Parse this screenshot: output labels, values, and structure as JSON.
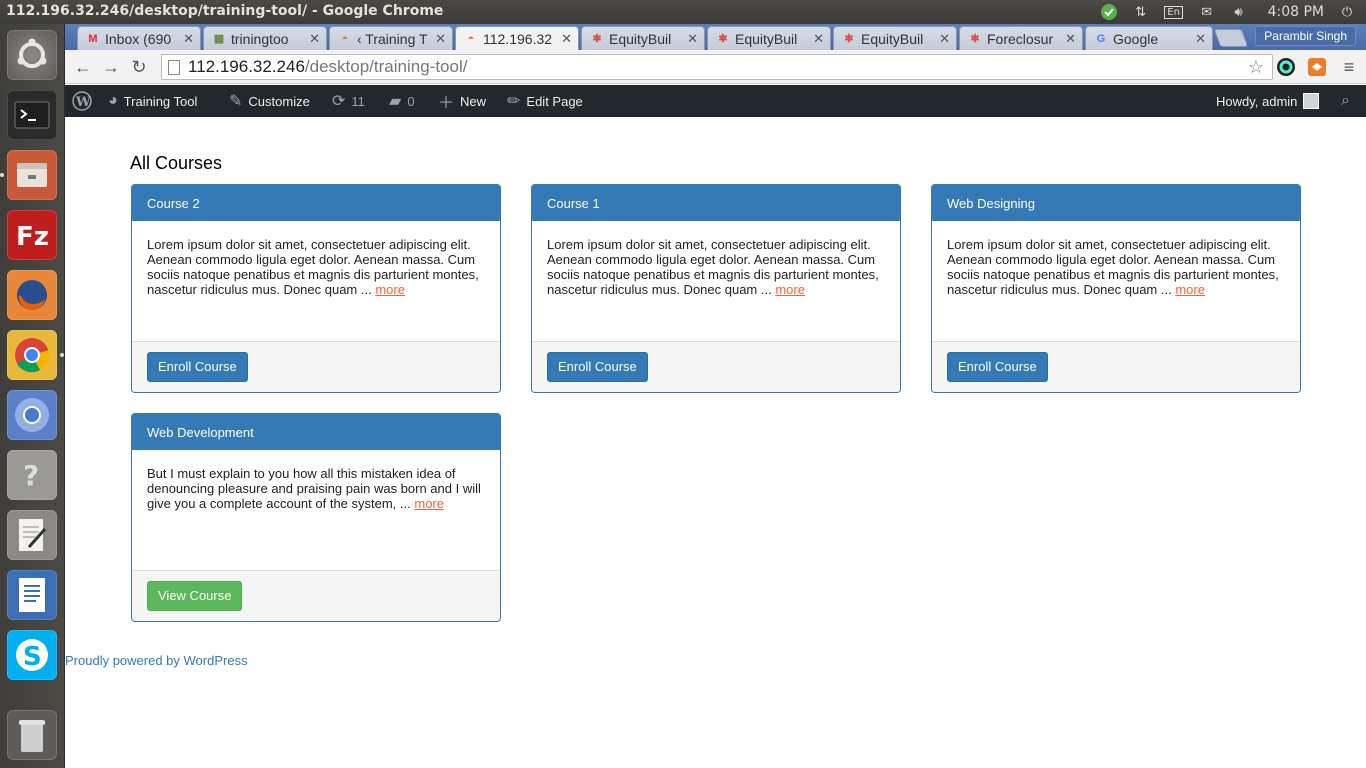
{
  "os_panel": {
    "window_title": "112.196.32.246/desktop/training-tool/ - Google Chrome",
    "keyboard_layout": "En",
    "clock": "4:08 PM",
    "icons": [
      "chrome-update-icon",
      "network-icon",
      "keyboard-icon",
      "mail-icon",
      "volume-icon"
    ]
  },
  "launcher": {
    "items": [
      "ubuntu-dash",
      "terminal",
      "files",
      "filezilla",
      "firefox",
      "chrome",
      "chromium",
      "help",
      "text-editor",
      "libreoffice-writer",
      "skype",
      "trash"
    ]
  },
  "browser": {
    "tabs": [
      {
        "label": "Inbox (690",
        "favicon": "gmail-icon"
      },
      {
        "label": "triningtoo",
        "favicon": "wp-icon"
      },
      {
        "label": "‹ Training T",
        "favicon": "wp-icon"
      },
      {
        "label": "112.196.32",
        "favicon": "wp-icon",
        "active": true
      },
      {
        "label": "EquityBuil",
        "favicon": "joomla-icon"
      },
      {
        "label": "EquityBuil",
        "favicon": "joomla-icon"
      },
      {
        "label": "EquityBuil",
        "favicon": "joomla-icon"
      },
      {
        "label": "Foreclosur",
        "favicon": "joomla-icon"
      },
      {
        "label": "Google",
        "favicon": "google-icon"
      }
    ],
    "profile_name": "Parambir Singh",
    "url_host": "112.196.32.246",
    "url_path": "/desktop/training-tool/"
  },
  "admin_bar": {
    "site_name": "Training Tool",
    "customize": "Customize",
    "updates_count": "11",
    "comments_count": "0",
    "new_label": "New",
    "edit_page": "Edit Page",
    "greeting": "Howdy, admin"
  },
  "page": {
    "heading": "All Courses",
    "more_label": "more",
    "courses": [
      {
        "title": "Course 2",
        "excerpt": "Lorem ipsum dolor sit amet, consectetuer adipiscing elit. Aenean commodo ligula eget dolor. Aenean massa. Cum sociis natoque penatibus et magnis dis parturient montes, nascetur ridiculus mus. Donec quam ...",
        "button": "Enroll Course"
      },
      {
        "title": "Course 1",
        "excerpt": "Lorem ipsum dolor sit amet, consectetuer adipiscing elit. Aenean commodo ligula eget dolor. Aenean massa. Cum sociis natoque penatibus et magnis dis parturient montes, nascetur ridiculus mus. Donec quam ...",
        "button": "Enroll Course"
      },
      {
        "title": "Web Designing",
        "excerpt": "Lorem ipsum dolor sit amet, consectetuer adipiscing elit. Aenean commodo ligula eget dolor. Aenean massa. Cum sociis natoque penatibus et magnis dis parturient montes, nascetur ridiculus mus. Donec quam ...",
        "button": "Enroll Course"
      },
      {
        "title": "Web Development",
        "excerpt": "But I must explain to you how all this mistaken idea of denouncing pleasure and praising pain was born and I will give you a complete account of the system, ...",
        "button": "View Course"
      }
    ],
    "footer": "Proudly powered by WordPress"
  }
}
